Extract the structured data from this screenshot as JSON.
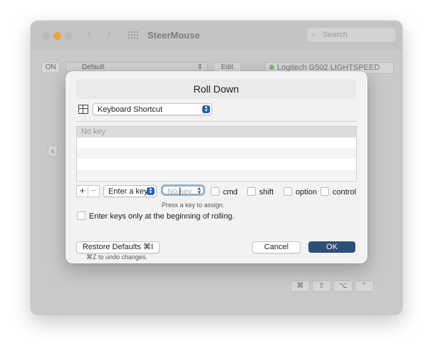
{
  "window": {
    "app_title": "SteerMouse",
    "search_placeholder": "Search",
    "on_label": "ON",
    "profile_value": "Default",
    "edit_label": "Edit",
    "device_name": "Logitech G502 LIGHTSPEED",
    "device_status_color": "#7fb37a",
    "side_arrow": "‹",
    "bottom_keys": [
      "⌘",
      "⇧",
      "⌥",
      "⌃"
    ]
  },
  "dialog": {
    "title": "Roll Down",
    "action_type": "Keyboard Shortcut",
    "key_list": [
      {
        "label": "No key",
        "selected": true
      },
      {
        "label": ""
      },
      {
        "label": ""
      },
      {
        "label": ""
      },
      {
        "label": ""
      }
    ],
    "add_label": "+",
    "remove_label": "−",
    "key_mode": "Enter a key",
    "key_placeholder": "No key",
    "modifiers": {
      "cmd": "cmd",
      "shift": "shift",
      "option": "option",
      "control": "control"
    },
    "hint": "Press a key to assign.",
    "rolling_option": "Enter keys only at the beginning of rolling.",
    "restore_label": "Restore Defaults ⌘I",
    "undo_hint": "⌘Z to undo changes.",
    "cancel_label": "Cancel",
    "ok_label": "OK",
    "accent_color": "#2e4f77"
  }
}
